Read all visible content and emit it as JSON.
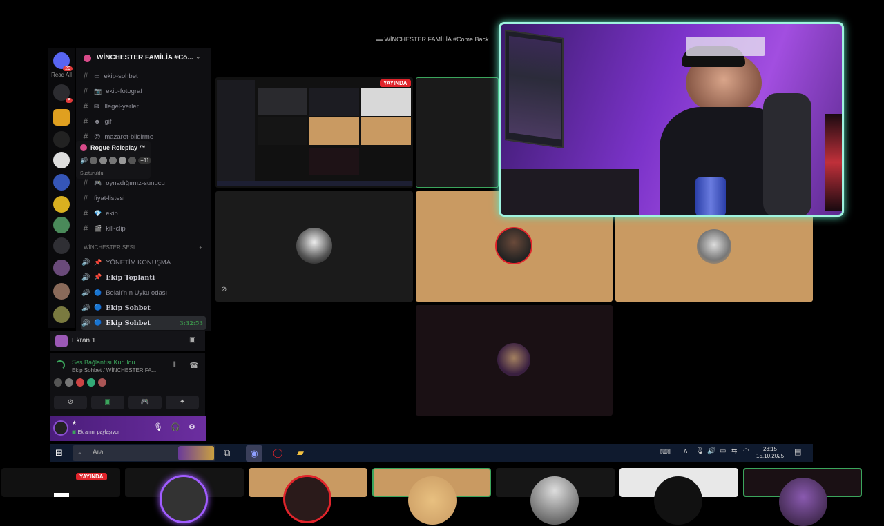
{
  "window": {
    "title": "WİNCHESTER FAMİLİA #Come Back"
  },
  "rail": {
    "read_all": "Read All",
    "badges": {
      "first": "20",
      "second": "8"
    }
  },
  "server": {
    "name": "WİNCHESTER FAMİLİA #Co..."
  },
  "text_channels": [
    {
      "emoji": "▭",
      "name": "ekip-sohbet"
    },
    {
      "emoji": "📷",
      "name": "ekip-fotograf"
    },
    {
      "emoji": "✉",
      "name": "illegel-yerler"
    },
    {
      "emoji": "☻",
      "name": "gif"
    },
    {
      "emoji": "😕",
      "name": "mazaret-bildirme"
    },
    {
      "emoji": "",
      "name": ""
    },
    {
      "emoji": "",
      "name": ""
    },
    {
      "emoji": "🎮",
      "name": "oynadığımız-sunucu"
    },
    {
      "emoji": "",
      "name": "fiyat-listesi"
    },
    {
      "emoji": "💎",
      "name": "ekip"
    },
    {
      "emoji": "🎬",
      "name": "kill-clip"
    }
  ],
  "voice_category": {
    "name": "WİNCHESTER SESLİ",
    "add": "+"
  },
  "voice_channels": [
    {
      "emoji": "📌",
      "name": "YÖNETİM KONUŞMA"
    },
    {
      "emoji": "📌",
      "name": "Ekip Toplanti"
    },
    {
      "emoji": "🔵",
      "name": "Belalı'nın Uyku odası"
    },
    {
      "emoji": "🔵",
      "name": "Ekip Sohbet"
    },
    {
      "emoji": "🔵",
      "name": "Ekip Sohbet",
      "time": "3:32:53"
    }
  ],
  "tooltip": {
    "title": "Rogue Roleplay ™",
    "count": "+11",
    "status": "Susturuldu"
  },
  "screen_panel": {
    "label": "Ekran 1"
  },
  "voice_panel": {
    "status": "Ses Bağlantısı Kuruldu",
    "channel": "Ekip Sohbet / WİNCHESTER FA..."
  },
  "user": {
    "name": "★",
    "status": "Ekranını paylaşıyor"
  },
  "video": {
    "live_label": "YAYINDA"
  },
  "taskbar": {
    "search": "Ara",
    "time": "23:15",
    "date": "15.10.2025"
  },
  "strip": {
    "live_label": "YAYINDA"
  },
  "colors": {
    "accent": "#9ff3df",
    "live": "#e0242b",
    "tile_tan": "#c99a62",
    "voice_green": "#3ba55c"
  }
}
